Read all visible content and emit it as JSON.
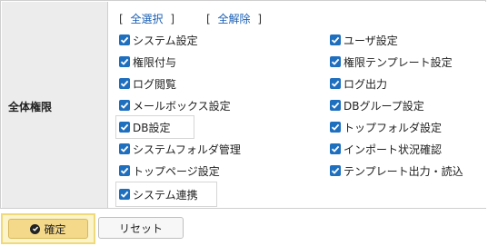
{
  "row_label": "全体権限",
  "select_all": {
    "open": "[",
    "label": "全選択",
    "close": "]"
  },
  "deselect_all": {
    "open": "[",
    "label": "全解除",
    "close": "]"
  },
  "permissions_left": [
    "システム設定",
    "権限付与",
    "ログ閲覧",
    "メールボックス設定",
    "DB設定",
    "システムフォルダ管理",
    "トップページ設定",
    "システム連携"
  ],
  "permissions_right": [
    "ユーザ設定",
    "権限テンプレート設定",
    "ログ出力",
    "DBグループ設定",
    "トップフォルダ設定",
    "インポート状況確認",
    "テンプレート出力・読込"
  ],
  "all_checked": true,
  "buttons": {
    "confirm": "確定",
    "reset": "リセット"
  },
  "colors": {
    "checkbox": "#1f6fbf",
    "confirm_bg": "#f5d98a",
    "label_bg": "#ececec"
  }
}
